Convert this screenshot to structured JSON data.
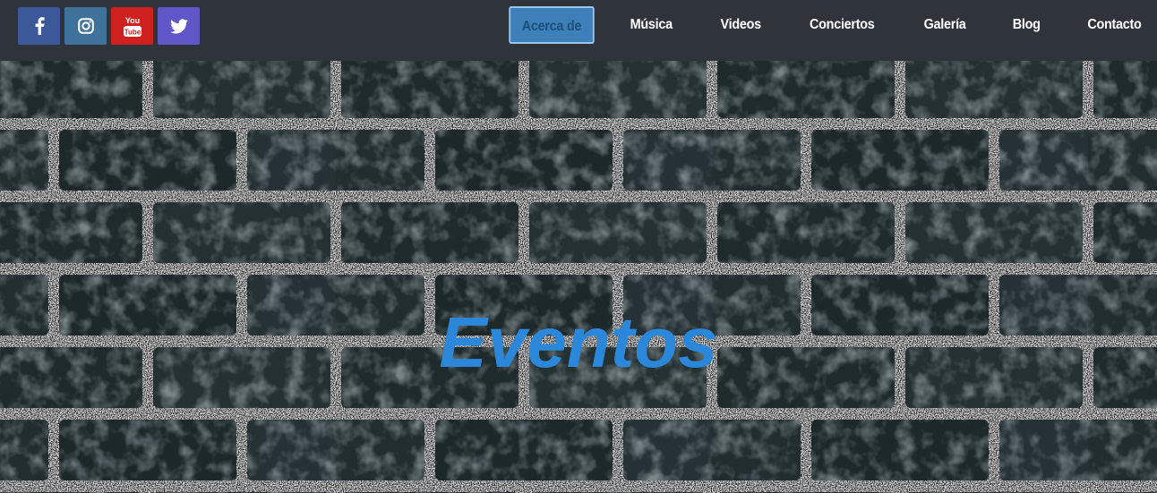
{
  "social": [
    {
      "name": "facebook",
      "icon": "facebook-icon",
      "color": "#3b5998"
    },
    {
      "name": "instagram",
      "icon": "instagram-icon",
      "color": "#3f729b"
    },
    {
      "name": "youtube",
      "icon": "youtube-icon",
      "color": "#cd201f",
      "icon_text_top": "You",
      "icon_text_bottom": "Tube"
    },
    {
      "name": "twitter",
      "icon": "twitter-icon",
      "color": "#5f57c8"
    }
  ],
  "nav": {
    "items": [
      "Acerca de",
      "Música",
      "Videos",
      "Conciertos",
      "Galería",
      "Blog",
      "Contacto"
    ],
    "active_index": 0
  },
  "hero": {
    "title": "Eventos",
    "title_color": "#2b87d9",
    "background": "brick-wall-image"
  }
}
